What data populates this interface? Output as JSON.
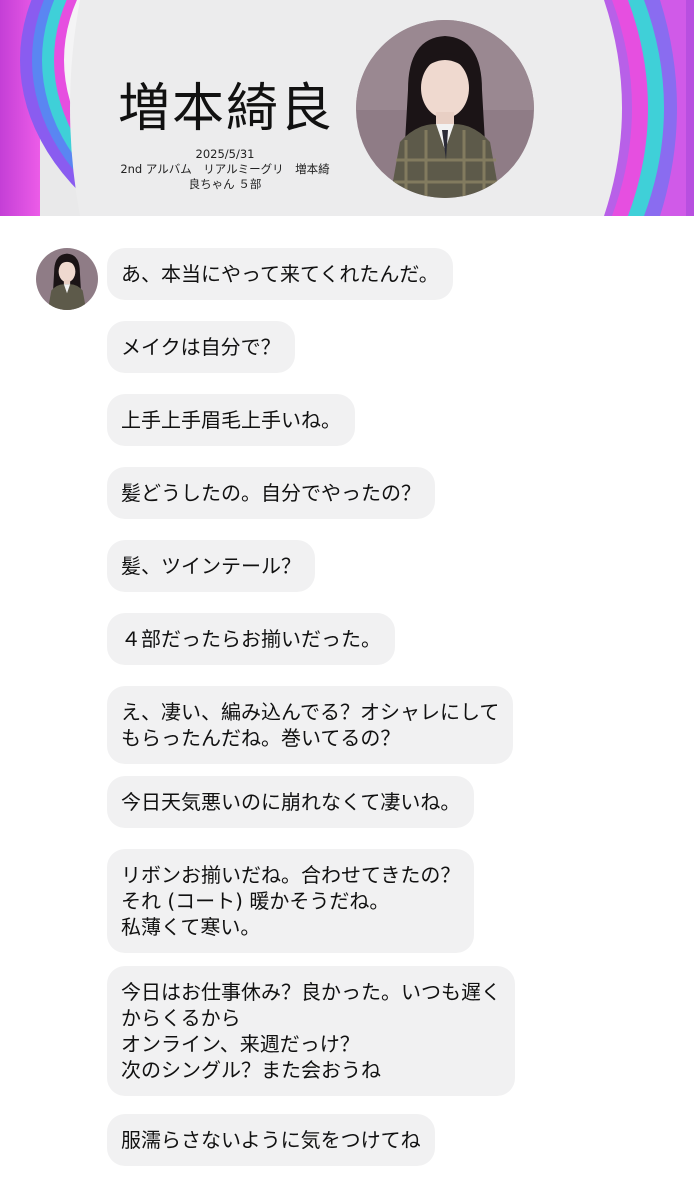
{
  "header": {
    "name": "増本綺良",
    "date": "2025/5/31",
    "event_line1": "2nd アルバム　リアルミーグリ　増本綺",
    "event_line2": "良ちゃん ５部"
  },
  "messages": [
    {
      "lines": [
        "あ、本当にやって来てくれたんだ。"
      ]
    },
    {
      "lines": [
        "メイクは自分で？"
      ]
    },
    {
      "lines": [
        "上手上手眉毛上手いね。"
      ]
    },
    {
      "lines": [
        "髪どうしたの。自分でやったの？"
      ]
    },
    {
      "lines": [
        "髪、ツインテール？"
      ]
    },
    {
      "lines": [
        "４部だったらお揃いだった。"
      ]
    },
    {
      "lines": [
        "え、凄い、編み込んでる？オシャレにして",
        "もらったんだね。巻いてるの？"
      ]
    },
    {
      "lines": [
        "今日天気悪いのに崩れなくて凄いね。"
      ]
    },
    {
      "lines": [
        "リボンお揃いだね。合わせてきたの？",
        "それ (コート) 暖かそうだね。",
        "私薄くて寒い。"
      ]
    },
    {
      "lines": [
        "今日はお仕事休み？良かった。いつも遅く",
        "からくるから",
        "オンライン、来週だっけ？",
        "次のシングル？また会おうね"
      ]
    },
    {
      "lines": [
        "服濡らさないように気をつけてね"
      ]
    }
  ],
  "colors": {
    "bubble_bg": "#f1f1f2",
    "banner_bg": "#e9e9ea",
    "ring_outer": "#e24fe0",
    "ring_cyan": "#3fd0d8",
    "ring_violet": "#8b5cf6"
  },
  "icons": {
    "avatar_large": "member-portrait",
    "avatar_small": "member-portrait"
  }
}
